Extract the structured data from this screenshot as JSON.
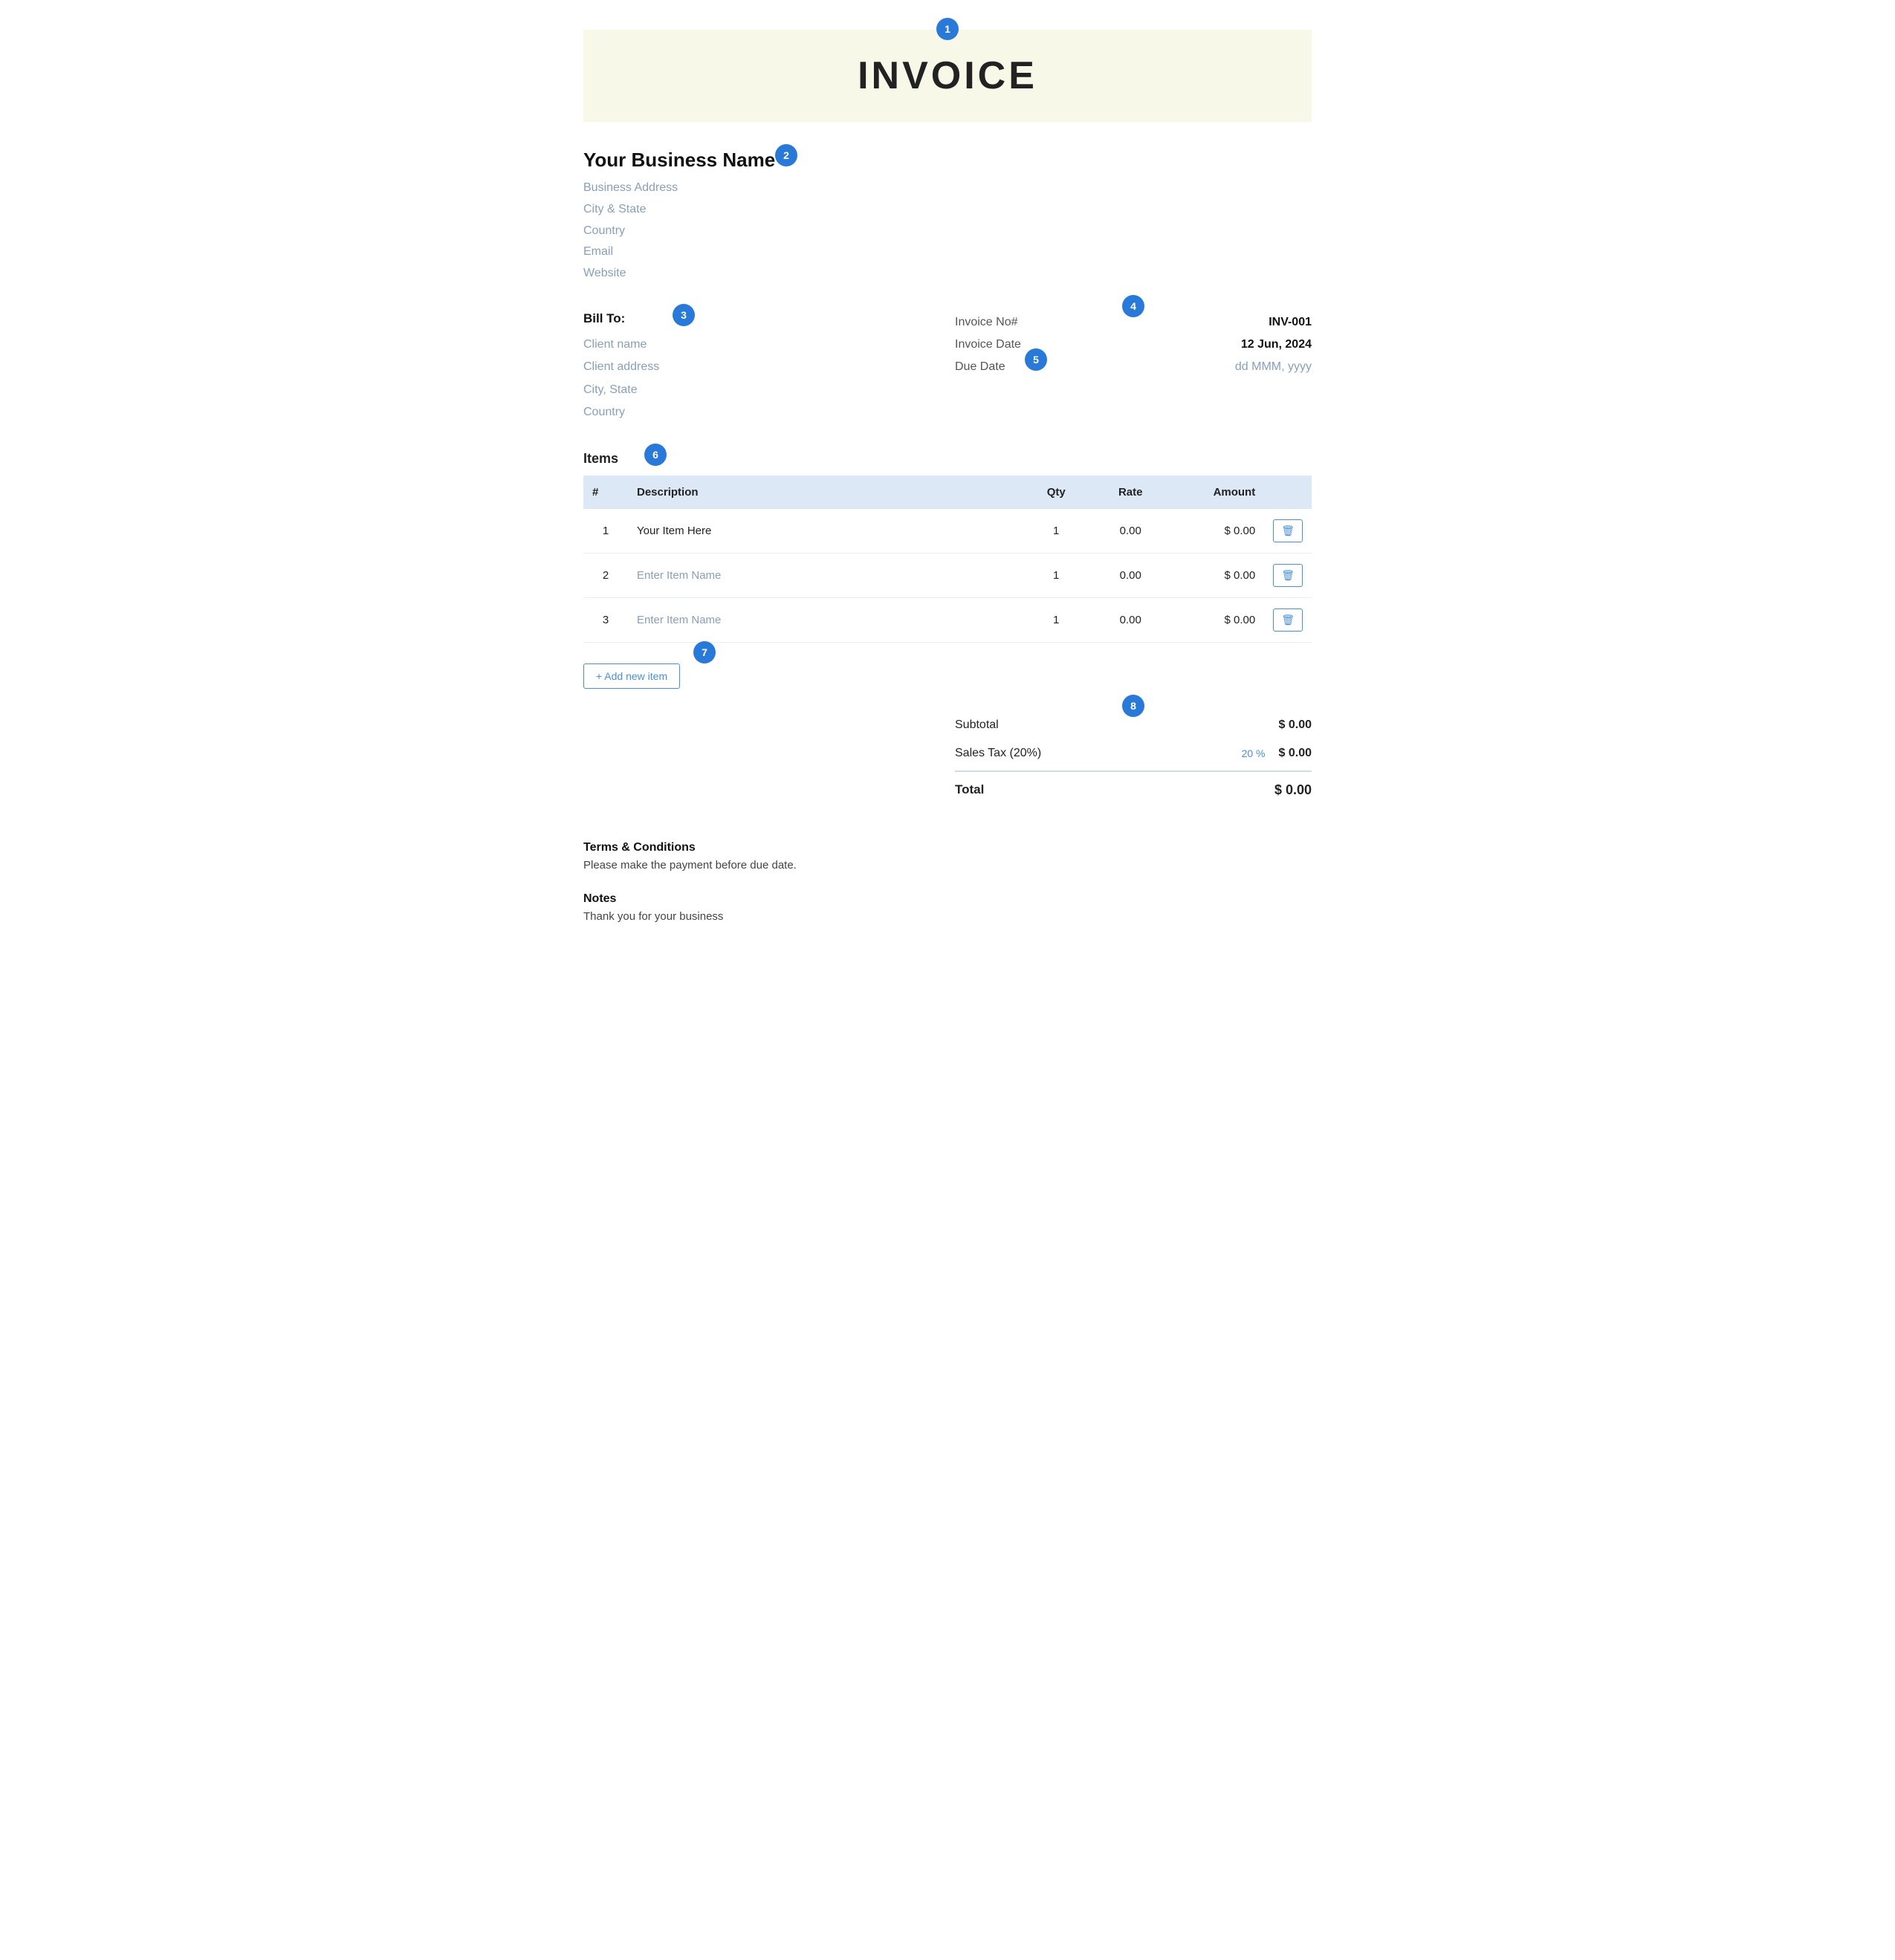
{
  "invoice": {
    "title": "INVOICE",
    "badge1": "1"
  },
  "business": {
    "badge": "2",
    "name": "Your Business Name",
    "address": "Business Address",
    "city_state": "City & State",
    "country": "Country",
    "email": "Email",
    "website": "Website"
  },
  "bill_to": {
    "badge": "3",
    "label": "Bill To:",
    "client_name": "Client name",
    "client_address": "Client address",
    "city_state": "City, State",
    "country": "Country"
  },
  "invoice_meta": {
    "badge": "4",
    "invoice_no_label": "Invoice No#",
    "invoice_no_value": "INV-001",
    "invoice_date_label": "Invoice Date",
    "invoice_date_value": "12 Jun, 2024",
    "due_date_label": "Due Date",
    "due_date_badge": "5",
    "due_date_value": "dd MMM, yyyy"
  },
  "items": {
    "badge": "6",
    "label": "Items",
    "columns": {
      "hash": "#",
      "description": "Description",
      "qty": "Qty",
      "rate": "Rate",
      "amount": "Amount"
    },
    "rows": [
      {
        "num": "1",
        "description": "Your Item Here",
        "qty": "1",
        "rate": "0.00",
        "amount": "$ 0.00",
        "placeholder": false
      },
      {
        "num": "2",
        "description": "Enter Item Name",
        "qty": "1",
        "rate": "0.00",
        "amount": "$ 0.00",
        "placeholder": true
      },
      {
        "num": "3",
        "description": "Enter Item Name",
        "qty": "1",
        "rate": "0.00",
        "amount": "$ 0.00",
        "placeholder": true
      }
    ],
    "add_button": "+ Add new item",
    "add_badge": "7"
  },
  "totals": {
    "badge": "8",
    "subtotal_label": "Subtotal",
    "subtotal_value": "$ 0.00",
    "tax_label": "Sales Tax (20%)",
    "tax_rate": "20 %",
    "tax_value": "$ 0.00",
    "total_label": "Total",
    "total_value": "$ 0.00"
  },
  "terms": {
    "title": "Terms & Conditions",
    "text": "Please make the payment before due date."
  },
  "notes": {
    "title": "Notes",
    "text": "Thank you for your business"
  }
}
